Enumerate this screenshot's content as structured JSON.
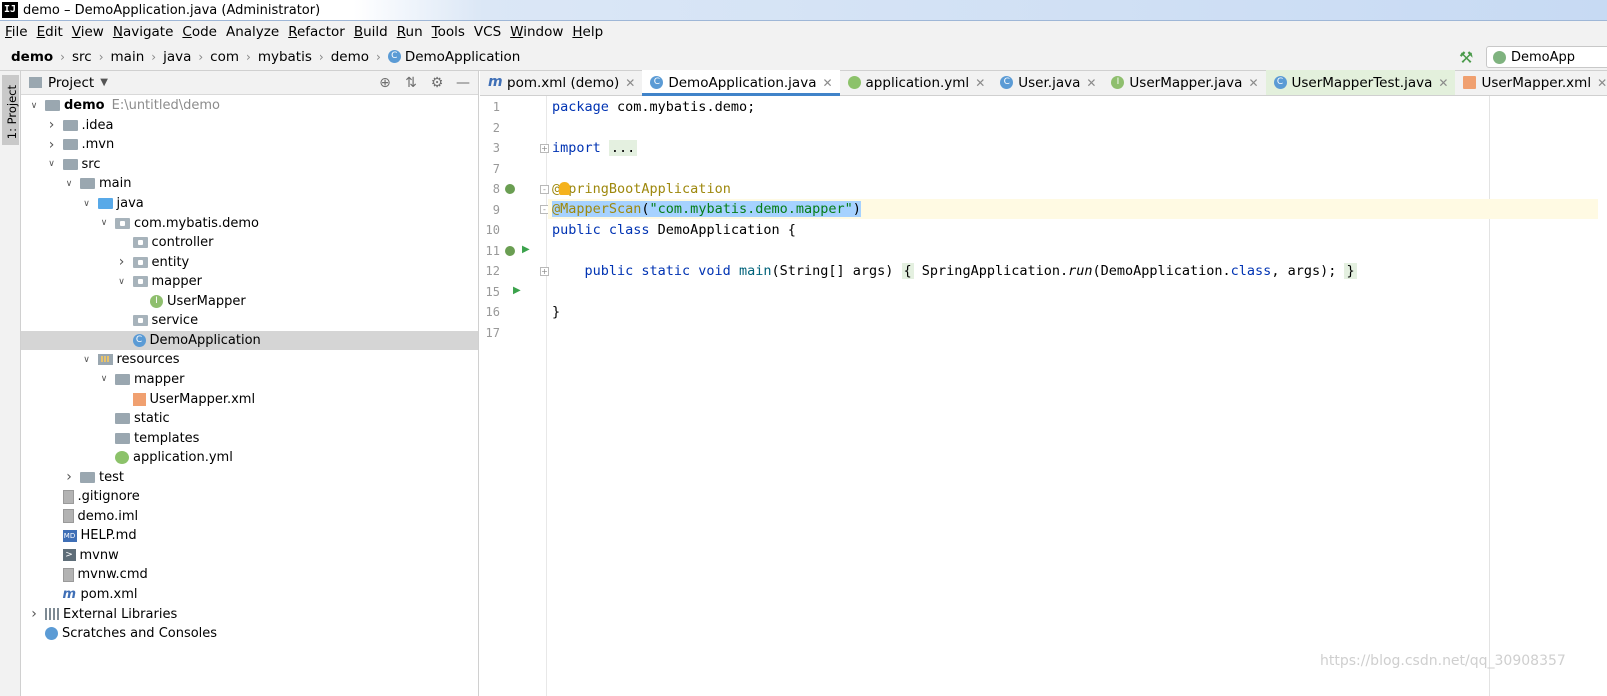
{
  "window": {
    "logo_text": "IJ",
    "title": "demo – DemoApplication.java (Administrator)"
  },
  "menu": [
    {
      "mnemonic": "F",
      "rest": "ile"
    },
    {
      "mnemonic": "E",
      "rest": "dit"
    },
    {
      "mnemonic": "V",
      "rest": "iew"
    },
    {
      "mnemonic": "N",
      "rest": "avigate"
    },
    {
      "mnemonic": "C",
      "rest": "ode"
    },
    {
      "mnemonic": "",
      "rest": "Analyze"
    },
    {
      "mnemonic": "R",
      "rest": "efactor"
    },
    {
      "mnemonic": "B",
      "rest": "uild"
    },
    {
      "mnemonic": "R",
      "rest": "un"
    },
    {
      "mnemonic": "T",
      "rest": "ools"
    },
    {
      "mnemonic": "",
      "rest": "VCS"
    },
    {
      "mnemonic": "W",
      "rest": "indow"
    },
    {
      "mnemonic": "H",
      "rest": "elp"
    }
  ],
  "breadcrumb": [
    "demo",
    "src",
    "main",
    "java",
    "com",
    "mybatis",
    "demo",
    "DemoApplication"
  ],
  "run_config": {
    "label": "DemoApp",
    "build_icon": "hammer-icon"
  },
  "tool_strip": {
    "label": "1: Project"
  },
  "project_panel": {
    "title": "Project",
    "tools": [
      "locate-icon",
      "collapse-icon",
      "gear-icon",
      "minimize-icon"
    ],
    "tree": [
      {
        "indent": 0,
        "toggle": "open",
        "icon": "folder",
        "label": "demo",
        "bold": true,
        "hint": "E:\\untitled\\demo"
      },
      {
        "indent": 1,
        "toggle": "closed",
        "icon": "folder",
        "label": ".idea"
      },
      {
        "indent": 1,
        "toggle": "closed",
        "icon": "folder",
        "label": ".mvn"
      },
      {
        "indent": 1,
        "toggle": "open",
        "icon": "folder",
        "label": "src"
      },
      {
        "indent": 2,
        "toggle": "open",
        "icon": "folder",
        "label": "main"
      },
      {
        "indent": 3,
        "toggle": "open",
        "icon": "folder-blue",
        "label": "java"
      },
      {
        "indent": 4,
        "toggle": "open",
        "icon": "package",
        "label": "com.mybatis.demo"
      },
      {
        "indent": 5,
        "toggle": "",
        "icon": "package",
        "label": "controller"
      },
      {
        "indent": 5,
        "toggle": "closed",
        "icon": "package",
        "label": "entity"
      },
      {
        "indent": 5,
        "toggle": "open",
        "icon": "package",
        "label": "mapper"
      },
      {
        "indent": 6,
        "toggle": "",
        "icon": "iface",
        "label": "UserMapper"
      },
      {
        "indent": 5,
        "toggle": "",
        "icon": "package",
        "label": "service"
      },
      {
        "indent": 5,
        "toggle": "",
        "icon": "cls",
        "label": "DemoApplication",
        "selected": true
      },
      {
        "indent": 3,
        "toggle": "open",
        "icon": "resources",
        "label": "resources"
      },
      {
        "indent": 4,
        "toggle": "open",
        "icon": "folder",
        "label": "mapper"
      },
      {
        "indent": 5,
        "toggle": "",
        "icon": "xml",
        "label": "UserMapper.xml"
      },
      {
        "indent": 4,
        "toggle": "",
        "icon": "folder",
        "label": "static"
      },
      {
        "indent": 4,
        "toggle": "",
        "icon": "folder",
        "label": "templates"
      },
      {
        "indent": 4,
        "toggle": "",
        "icon": "yml",
        "label": "application.yml"
      },
      {
        "indent": 2,
        "toggle": "closed",
        "icon": "folder",
        "label": "test"
      },
      {
        "indent": 1,
        "toggle": "",
        "icon": "file",
        "label": ".gitignore"
      },
      {
        "indent": 1,
        "toggle": "",
        "icon": "file",
        "label": "demo.iml"
      },
      {
        "indent": 1,
        "toggle": "",
        "icon": "md",
        "label": "HELP.md"
      },
      {
        "indent": 1,
        "toggle": "",
        "icon": "term",
        "label": "mvnw"
      },
      {
        "indent": 1,
        "toggle": "",
        "icon": "file",
        "label": "mvnw.cmd"
      },
      {
        "indent": 1,
        "toggle": "",
        "icon": "pom",
        "label": "pom.xml"
      },
      {
        "indent": 0,
        "toggle": "closed",
        "icon": "libs",
        "label": "External Libraries"
      },
      {
        "indent": 0,
        "toggle": "",
        "icon": "scratch",
        "label": "Scratches and Consoles"
      }
    ]
  },
  "tabs": [
    {
      "icon": "maven",
      "label": "pom.xml (demo)",
      "state": ""
    },
    {
      "icon": "java-c",
      "label": "DemoApplication.java",
      "state": "active"
    },
    {
      "icon": "yml",
      "label": "application.yml",
      "state": ""
    },
    {
      "icon": "java-c",
      "label": "User.java",
      "state": ""
    },
    {
      "icon": "java-i",
      "label": "UserMapper.java",
      "state": ""
    },
    {
      "icon": "java-c",
      "label": "UserMapperTest.java",
      "state": "modified"
    },
    {
      "icon": "xml",
      "label": "UserMapper.xml",
      "state": ""
    }
  ],
  "editor": {
    "line_numbers": [
      "1",
      "2",
      "3",
      "7",
      "8",
      "9",
      "10",
      "11",
      "12",
      "15",
      "16",
      "17"
    ],
    "code": {
      "l1_kw": "package",
      "l1_rest": " com.mybatis.demo;",
      "l3_kw": "import",
      "l3_fold": "...",
      "l8_at": "@",
      "l8_ann": "SpringBootApplication",
      "l9_ann": "@MapperScan",
      "l9_paren_open": "(",
      "l9_str": "\"com.mybatis.demo.mapper\"",
      "l9_paren_close": ")",
      "l10_kw": "public class",
      "l10_rest": " DemoApplication {",
      "l12_kw": "public static void",
      "l12_mth": "main",
      "l12_args": "(String[] args) ",
      "l12_fold_open": "{",
      "l12_body_a": " SpringApplication.",
      "l12_run": "run",
      "l12_body_b": "(DemoApplication.",
      "l12_class": "class",
      "l12_body_c": ", args); ",
      "l12_fold_close": "}",
      "l16_brace": "}"
    }
  },
  "watermark": "https://blog.csdn.net/qq_30908357"
}
